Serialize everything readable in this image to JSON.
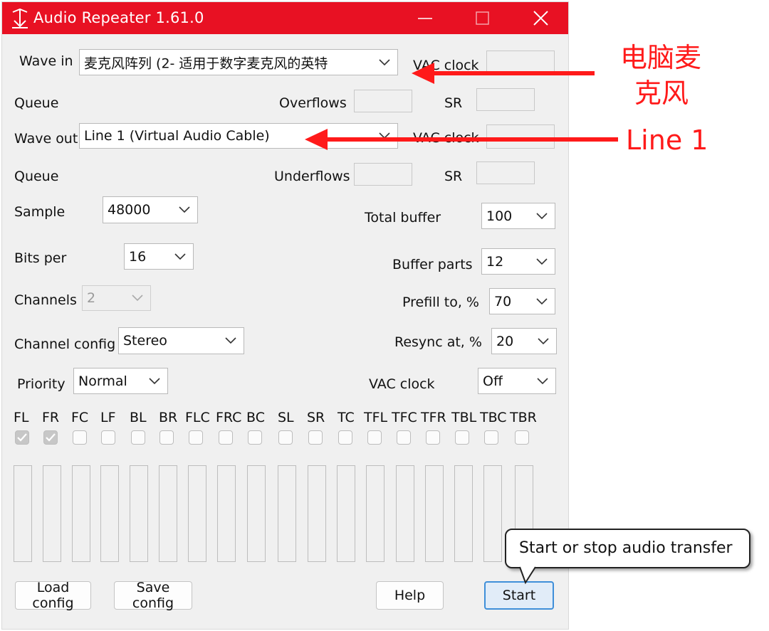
{
  "window": {
    "title": "Audio Repeater 1.61.0",
    "titlebar_color": "#e81123"
  },
  "wave_in": {
    "label": "Wave in",
    "value": "麦克风阵列 (2- 适用于数字麦克风的英特",
    "vac_clock_label": "VAC clock",
    "queue_label": "Queue",
    "overflows_label": "Overflows",
    "sr_label": "SR"
  },
  "wave_out": {
    "label": "Wave out",
    "value": "Line 1 (Virtual Audio Cable)",
    "vac_clock_label": "VAC clock",
    "queue_label": "Queue",
    "underflows_label": "Underflows",
    "sr_label": "SR"
  },
  "settings": {
    "sample_label": "Sample",
    "sample_value": "48000",
    "bits_label": "Bits per",
    "bits_value": "16",
    "channels_label": "Channels",
    "channels_value": "2",
    "channel_config_label": "Channel config",
    "channel_config_value": "Stereo",
    "priority_label": "Priority",
    "priority_value": "Normal",
    "total_buffer_label": "Total buffer",
    "total_buffer_value": "100",
    "buffer_parts_label": "Buffer parts",
    "buffer_parts_value": "12",
    "prefill_label": "Prefill to, %",
    "prefill_value": "70",
    "resync_label": "Resync at, %",
    "resync_value": "20",
    "vac_clock_label": "VAC clock",
    "vac_clock_value": "Off"
  },
  "channels": [
    {
      "name": "FL",
      "checked": true
    },
    {
      "name": "FR",
      "checked": true
    },
    {
      "name": "FC",
      "checked": false
    },
    {
      "name": "LF",
      "checked": false
    },
    {
      "name": "BL",
      "checked": false
    },
    {
      "name": "BR",
      "checked": false
    },
    {
      "name": "FLC",
      "checked": false
    },
    {
      "name": "FRC",
      "checked": false
    },
    {
      "name": "BC",
      "checked": false
    },
    {
      "name": "SL",
      "checked": false
    },
    {
      "name": "SR",
      "checked": false
    },
    {
      "name": "TC",
      "checked": false
    },
    {
      "name": "TFL",
      "checked": false
    },
    {
      "name": "TFC",
      "checked": false
    },
    {
      "name": "TFR",
      "checked": false
    },
    {
      "name": "TBL",
      "checked": false
    },
    {
      "name": "TBC",
      "checked": false
    },
    {
      "name": "TBR",
      "checked": false
    }
  ],
  "buttons": {
    "load": "Load config",
    "save": "Save config",
    "help": "Help",
    "start": "Start"
  },
  "tooltip": "Start or stop audio transfer",
  "annotations": {
    "mic_line1": "电脑麦",
    "mic_line2": "克风",
    "line1": "Line 1",
    "color": "#ff1a1a"
  }
}
